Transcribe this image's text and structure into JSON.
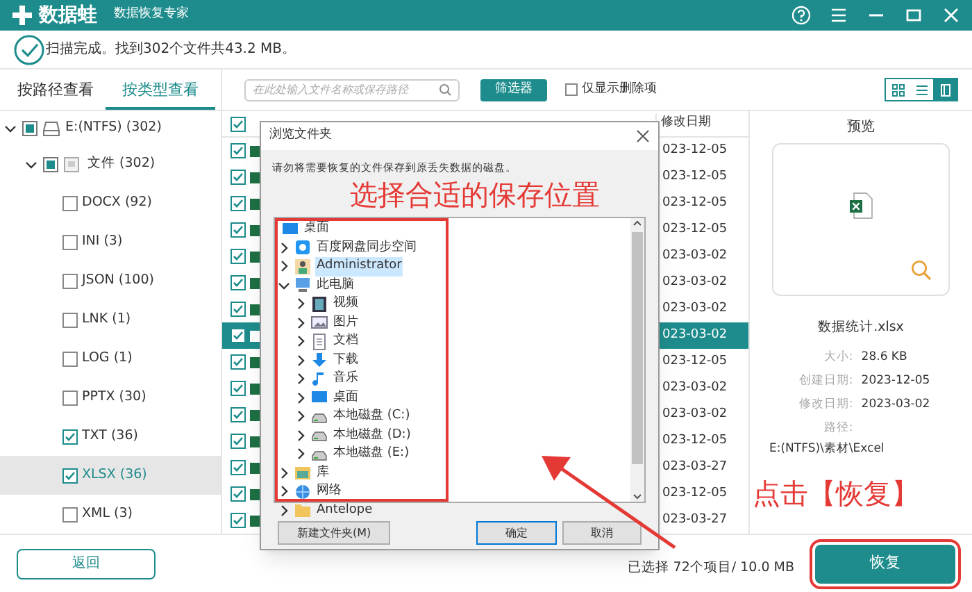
{
  "title_bar": {
    "brand": "数据蛙",
    "subtitle": "数据恢复专家"
  },
  "status": "扫描完成。找到302个文件共43.2 MB。",
  "view_tabs": [
    {
      "label": "按路径查看",
      "selected": false
    },
    {
      "label": "按类型查看",
      "selected": true
    }
  ],
  "toolbar": {
    "search": {
      "placeholder": "在此处输入文件名称或保存路径"
    },
    "filter_button": "筛选器",
    "deleted_only": {
      "label": "仅显示删除项",
      "checked": false
    },
    "view_modes": [
      {
        "selected": false
      },
      {
        "selected": false
      },
      {
        "selected": true
      }
    ]
  },
  "type_tree": {
    "label": "E:(NTFS) (302)",
    "indeterminate": true,
    "expanded": true,
    "children": [
      {
        "label": "文件 (302)",
        "indeterminate": true,
        "expanded": true,
        "children": [
          {
            "label": "DOCX (92)",
            "checked": false,
            "selected": false
          },
          {
            "label": "INI (3)",
            "checked": false,
            "selected": false
          },
          {
            "label": "JSON (100)",
            "checked": false,
            "selected": false
          },
          {
            "label": "LNK (1)",
            "checked": false,
            "selected": false
          },
          {
            "label": "LOG (1)",
            "checked": false,
            "selected": false
          },
          {
            "label": "PPTX (30)",
            "checked": false,
            "selected": false
          },
          {
            "label": "TXT (36)",
            "checked": true,
            "selected": false
          },
          {
            "label": "XLSX (36)",
            "checked": true,
            "selected": true
          },
          {
            "label": "XML (3)",
            "checked": false,
            "selected": false
          }
        ]
      }
    ]
  },
  "back_button": "返回",
  "table": {
    "header_checked": true,
    "columns": [
      "修改日期"
    ],
    "rows": [
      {
        "checked": true,
        "selected": false,
        "modified": "023-12-05"
      },
      {
        "checked": true,
        "selected": false,
        "modified": "023-12-05"
      },
      {
        "checked": true,
        "selected": false,
        "modified": "023-12-05"
      },
      {
        "checked": true,
        "selected": false,
        "modified": "023-12-05"
      },
      {
        "checked": true,
        "selected": false,
        "modified": "023-03-02"
      },
      {
        "checked": true,
        "selected": false,
        "modified": "023-03-02"
      },
      {
        "checked": true,
        "selected": false,
        "modified": "023-03-02"
      },
      {
        "checked": true,
        "selected": true,
        "modified": "023-03-02"
      },
      {
        "checked": true,
        "selected": false,
        "modified": "023-12-05"
      },
      {
        "checked": true,
        "selected": false,
        "modified": "023-03-02"
      },
      {
        "checked": true,
        "selected": false,
        "modified": "023-03-02"
      },
      {
        "checked": true,
        "selected": false,
        "modified": "023-12-05"
      },
      {
        "checked": true,
        "selected": false,
        "modified": "023-03-27"
      },
      {
        "checked": true,
        "selected": false,
        "modified": "023-12-05"
      },
      {
        "checked": true,
        "selected": false,
        "modified": "023-03-27"
      }
    ]
  },
  "preview": {
    "title": "预览",
    "file_name": "数据统计.xlsx",
    "details": [
      {
        "label": "大小:",
        "value": "28.6 KB"
      },
      {
        "label": "创建日期:",
        "value": "2023-12-05"
      },
      {
        "label": "修改日期:",
        "value": "2023-03-02"
      }
    ],
    "path_label": "路径:",
    "path": "E:(NTFS)\\素材\\Excel"
  },
  "selection_summary": "已选择 72个项目/ 10.0 MB",
  "recover_button": "恢复",
  "dialog": {
    "title": "浏览文件夹",
    "message": "请勿将需要恢复的文件保存到原丢失数据的磁盘。",
    "tree": {
      "label": "桌面",
      "kind": "desktop",
      "selected": false,
      "children": [
        {
          "label": "百度网盘同步空间",
          "kind": "cloud",
          "expanded": false,
          "selected": false
        },
        {
          "label": "Administrator",
          "kind": "user",
          "expanded": false,
          "selected": true
        },
        {
          "label": "此电脑",
          "kind": "pc",
          "expanded": true,
          "selected": false,
          "children": [
            {
              "label": "视频",
              "kind": "video",
              "expanded": false,
              "selected": false
            },
            {
              "label": "图片",
              "kind": "image",
              "expanded": false,
              "selected": false
            },
            {
              "label": "文档",
              "kind": "doc",
              "expanded": false,
              "selected": false
            },
            {
              "label": "下载",
              "kind": "download",
              "expanded": false,
              "selected": false
            },
            {
              "label": "音乐",
              "kind": "music",
              "expanded": false,
              "selected": false
            },
            {
              "label": "桌面",
              "kind": "desktop",
              "expanded": false,
              "selected": false
            },
            {
              "label": "本地磁盘 (C:)",
              "kind": "drive",
              "expanded": false,
              "selected": false
            },
            {
              "label": "本地磁盘 (D:)",
              "kind": "drive",
              "expanded": false,
              "selected": false
            },
            {
              "label": "本地磁盘 (E:)",
              "kind": "drive",
              "expanded": false,
              "selected": false
            }
          ]
        },
        {
          "label": "库",
          "kind": "library",
          "expanded": false,
          "selected": false
        },
        {
          "label": "网络",
          "kind": "network",
          "expanded": false,
          "selected": false
        },
        {
          "label": "Antelope",
          "kind": "folder",
          "expanded": false,
          "selected": false
        }
      ]
    },
    "buttons": [
      {
        "label": "新建文件夹(M)",
        "default": false
      },
      {
        "label": "确定",
        "default": true
      },
      {
        "label": "取消",
        "default": false
      }
    ]
  },
  "annotations": [
    "选择合适的保存位置",
    "点击【恢复】"
  ]
}
